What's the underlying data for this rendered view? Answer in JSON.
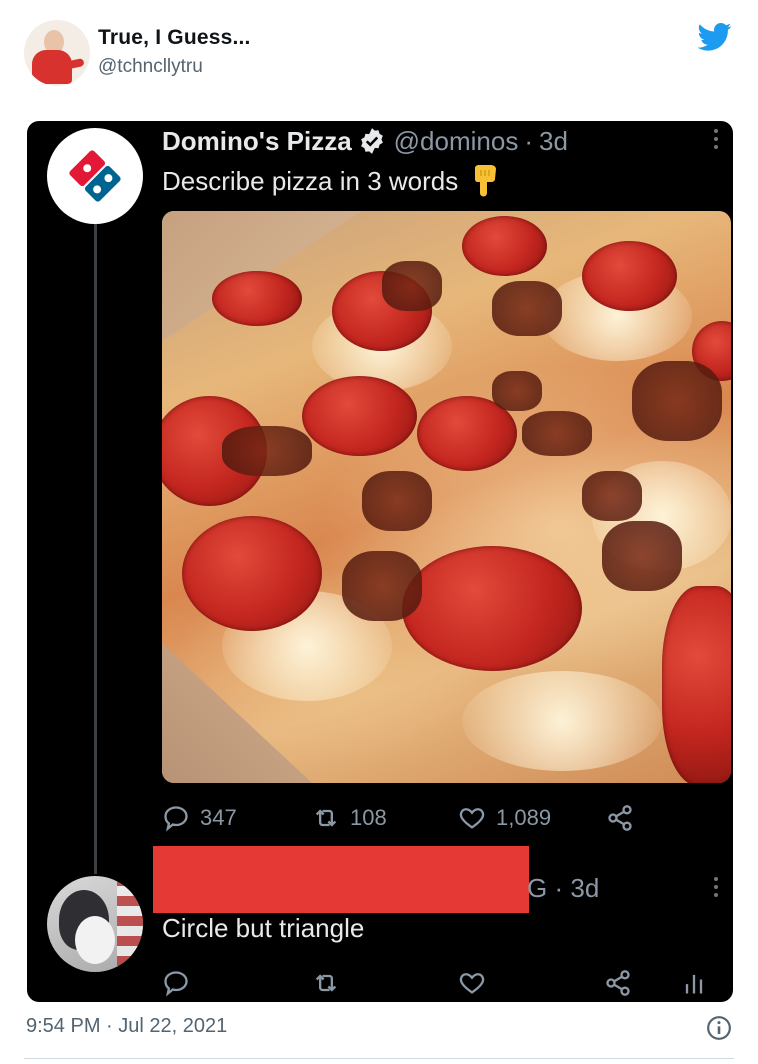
{
  "outer_tweet": {
    "display_name": "True, I Guess...",
    "handle": "@tchncllytru",
    "timestamp": "9:54 PM · Jul 22, 2021",
    "avatar_icon": "person-avatar",
    "platform_icon": "twitter-bird-icon",
    "accent_color": "#1d9bf0"
  },
  "embedded_tweet": {
    "display_name": "Domino's Pizza",
    "verified_icon": "verified-badge-icon",
    "handle": "@dominos",
    "separator": "·",
    "age": "3d",
    "text": "Describe pizza in 3 words",
    "emoji_icon": "pointing-down-icon",
    "image": "pizza-photo",
    "stats": {
      "replies": "347",
      "retweets": "108",
      "likes": "1,089"
    }
  },
  "reply_tweet": {
    "handle_suffix": "G",
    "separator": "·",
    "age": "3d",
    "text": "Circle but triangle",
    "redaction_color": "#e53935"
  },
  "colors": {
    "dark_bg": "#000000",
    "dark_text": "#e7e9ea",
    "dark_muted": "#8b98a5",
    "light_muted": "#536471",
    "dominos_blue": "#006491",
    "dominos_red": "#e31837"
  }
}
